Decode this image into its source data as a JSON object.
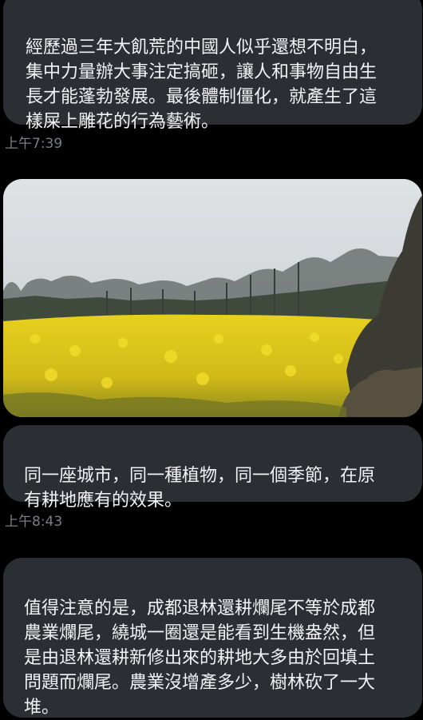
{
  "messages": [
    {
      "text": "經歷過三年大飢荒的中國人似乎還想不明白，\n集中力量辦大事注定搞砸，讓人和事物自由生\n長才能蓬勃發展。最後體制僵化，就產生了這\n樣屎上雕花的行為藝術。",
      "time": "上午7:39"
    },
    {
      "image": "rapeseed-field-photo"
    },
    {
      "text": "同一座城市，同一種植物，同一個季節，在原\n有耕地應有的效果。",
      "time": "上午8:43"
    },
    {
      "text": "值得注意的是，成都退林還耕爛尾不等於成都\n農業爛尾，繞城一圈還是能看到生機盎然，但\n是由退林還耕新修出來的耕地大多由於回填土\n問題而爛尾。農業沒增產多少，樹林砍了一大\n堆。"
    }
  ],
  "colors": {
    "background": "#000000",
    "bubble": "#2b2e33",
    "text": "#f2f3f5",
    "timestamp": "#7b7e84",
    "flowers": "#e9d21c"
  }
}
